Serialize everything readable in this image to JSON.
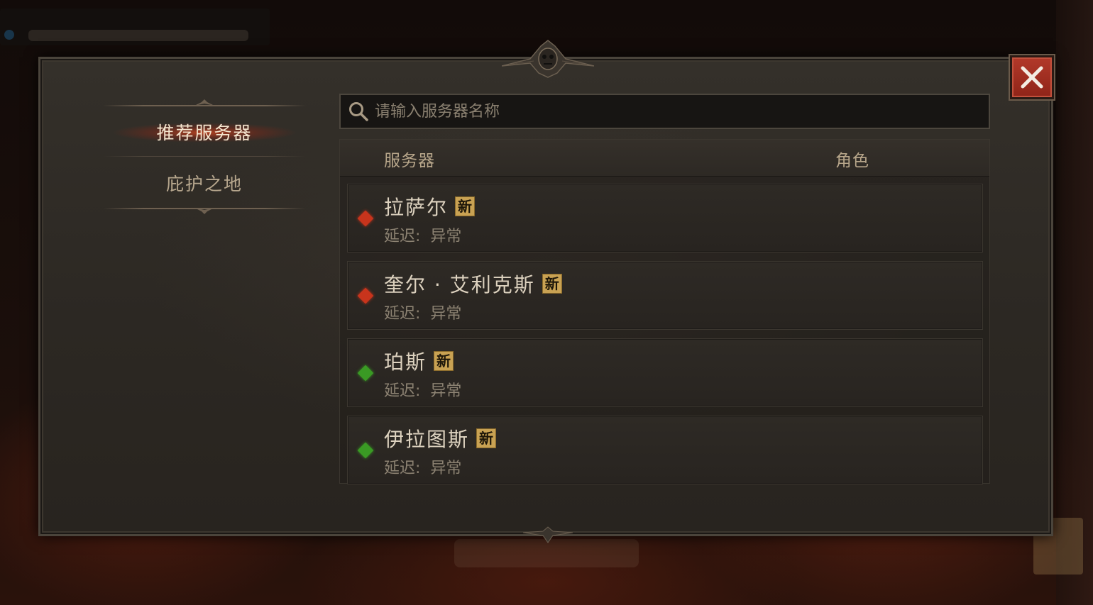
{
  "dialog": {
    "close_icon": "close-x-icon"
  },
  "nav": {
    "items": [
      {
        "label": "推荐服务器",
        "active": true
      },
      {
        "label": "庇护之地",
        "active": false
      }
    ]
  },
  "search": {
    "placeholder": "请输入服务器名称",
    "value": "",
    "icon": "search-icon"
  },
  "table": {
    "headers": {
      "server": "服务器",
      "role": "角色"
    },
    "rows": [
      {
        "name": "拉萨尔",
        "badge": "新",
        "latency_label": "延迟:",
        "latency_value": "异常",
        "status_color": "#c8341c"
      },
      {
        "name": "奎尔 · 艾利克斯",
        "badge": "新",
        "latency_label": "延迟:",
        "latency_value": "异常",
        "status_color": "#c8341c"
      },
      {
        "name": "珀斯",
        "badge": "新",
        "latency_label": "延迟:",
        "latency_value": "异常",
        "status_color": "#3a9a24"
      },
      {
        "name": "伊拉图斯",
        "badge": "新",
        "latency_label": "延迟:",
        "latency_value": "异常",
        "status_color": "#3a9a24"
      }
    ]
  },
  "colors": {
    "accent_glow": "#dc461e",
    "badge_gold": "#c9a253",
    "close_red": "#b2392a"
  }
}
